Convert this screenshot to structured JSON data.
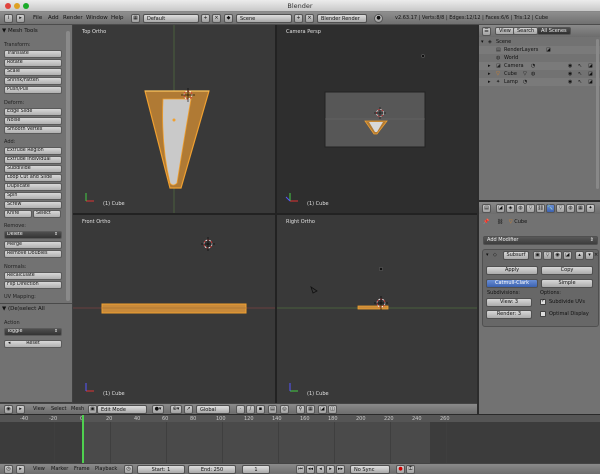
{
  "window": {
    "title": "Blender"
  },
  "info": {
    "menus": [
      "File",
      "Add",
      "Render",
      "Window",
      "Help"
    ],
    "layout": "Default",
    "scene": "Scene",
    "engine": "Blender Render",
    "stats": "v2.63.17 | Verts:8/8 | Edges:12/12 | Faces:6/6 | Tris:12 | Cube"
  },
  "toolshelf": {
    "header": "Mesh Tools",
    "transform_label": "Transform:",
    "transform": [
      "Translate",
      "Rotate",
      "Scale",
      "Shrink/Fatten",
      "Push/Pull"
    ],
    "deform_label": "Deform:",
    "deform": [
      "Edge Slide",
      "Noise",
      "Smooth Vertex"
    ],
    "add_label": "Add:",
    "add": [
      "Extrude Region",
      "Extrude Individual",
      "Subdivide",
      "Loop Cut and Slide",
      "Duplicate",
      "Spin",
      "Screw"
    ],
    "knife": "Knife",
    "select": "Select",
    "remove_label": "Remove:",
    "delete": "Delete",
    "merge": "Merge",
    "remove_doubles": "Remove Doubles",
    "normals_label": "Normals:",
    "recalculate": "Recalculate",
    "flip_direction": "Flip Direction",
    "uv_label": "UV Mapping:",
    "op_header": "(De)select All",
    "action_label": "Action",
    "action_value": "Toggle",
    "reset": "Reset"
  },
  "viewports": {
    "top": {
      "label": "Top Ortho",
      "object": "(1) Cube"
    },
    "camera": {
      "label": "Camera Persp",
      "object": "(1) Cube"
    },
    "front": {
      "label": "Front Ortho",
      "object": "(1) Cube"
    },
    "right": {
      "label": "Right Ortho",
      "object": "(1) Cube"
    }
  },
  "view3d_header": {
    "menus": [
      "View",
      "Select",
      "Mesh"
    ],
    "mode": "Edit Mode",
    "orientation": "Global"
  },
  "timeline": {
    "ticks": [
      "-40",
      "-20",
      "0",
      "20",
      "40",
      "60",
      "80",
      "100",
      "120",
      "140",
      "160",
      "180",
      "200",
      "220",
      "240",
      "260"
    ],
    "menus": [
      "View",
      "Marker",
      "Frame",
      "Playback"
    ],
    "start": "Start: 1",
    "end": "End: 250",
    "current": "1",
    "sync": "No Sync"
  },
  "outliner": {
    "tabs": [
      "View",
      "Search",
      "All Scenes"
    ],
    "rows": [
      "Scene",
      "RenderLayers",
      "World",
      "Camera",
      "Cube",
      "Lamp"
    ]
  },
  "properties": {
    "object_name": "Cube",
    "add_modifier": "Add Modifier",
    "modifier_name": "Subsurf",
    "apply": "Apply",
    "copy": "Copy",
    "catmull": "Catmull-Clark",
    "simple": "Simple",
    "subdivisions_label": "Subdivisions:",
    "view_value": "View: 3",
    "render_value": "Render: 3",
    "options_label": "Options:",
    "subdivide_uvs": "Subdivide UVs",
    "optimal_display": "Optimal Display"
  },
  "colors": {
    "selection": "#f0a030",
    "accent_blue": "#4a73c4"
  }
}
